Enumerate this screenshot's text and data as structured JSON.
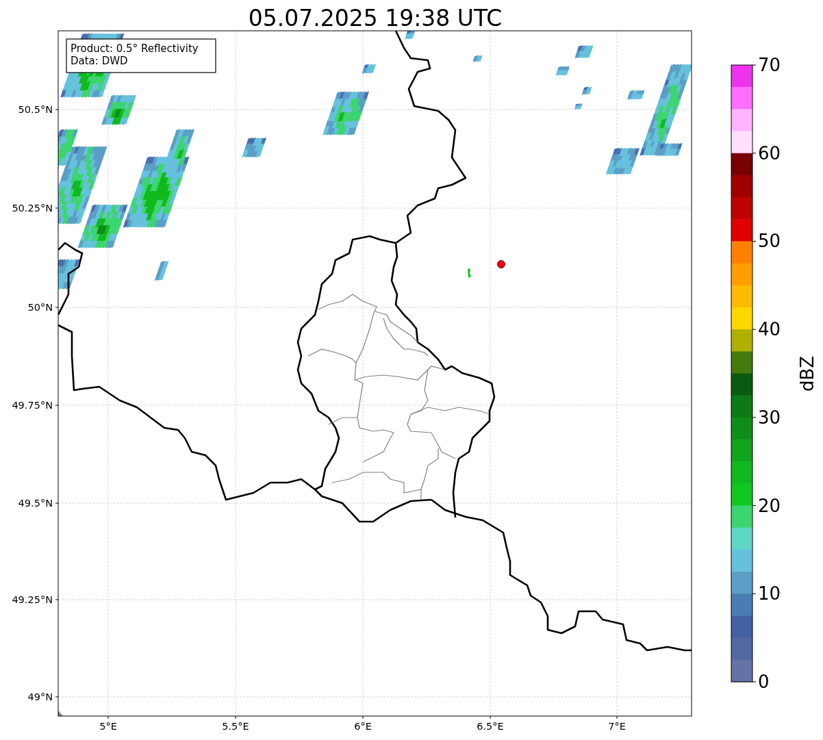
{
  "title": "05.07.2025 19:38 UTC",
  "info_box": [
    "Product: 0.5° Reflectivity",
    "Data: DWD"
  ],
  "lat_ticks": [
    "50.5°N",
    "50.25°N",
    "50°N",
    "49.75°N",
    "49.5°N",
    "49.25°N",
    "49°N"
  ],
  "lon_ticks": [
    "5°E",
    "5.5°E",
    "6°E",
    "6.5°E",
    "7°E"
  ],
  "colorbar": {
    "label": "dBZ",
    "ticks": [
      "70",
      "60",
      "50",
      "40",
      "30",
      "20",
      "10",
      "0"
    ],
    "bins": [
      {
        "color": "#ee33ee"
      },
      {
        "color": "#ff6eff"
      },
      {
        "color": "#ffb4ff"
      },
      {
        "color": "#ffe0ff"
      },
      {
        "color": "#780000"
      },
      {
        "color": "#a00000"
      },
      {
        "color": "#c00000"
      },
      {
        "color": "#e00000"
      },
      {
        "color": "#ff8000"
      },
      {
        "color": "#ff9e00"
      },
      {
        "color": "#ffbb00"
      },
      {
        "color": "#ffd700"
      },
      {
        "color": "#b0b000"
      },
      {
        "color": "#457a0e"
      },
      {
        "color": "#0a5a0f"
      },
      {
        "color": "#0c7a15"
      },
      {
        "color": "#0e8e18"
      },
      {
        "color": "#10a51c"
      },
      {
        "color": "#10b91e"
      },
      {
        "color": "#10c81e"
      },
      {
        "color": "#3dd56f"
      },
      {
        "color": "#5ed7c6"
      },
      {
        "color": "#66c1dc"
      },
      {
        "color": "#5b9ec6"
      },
      {
        "color": "#4a7db5"
      },
      {
        "color": "#4461a4"
      },
      {
        "color": "#5169a0"
      },
      {
        "color": "#6472a6"
      }
    ]
  }
}
